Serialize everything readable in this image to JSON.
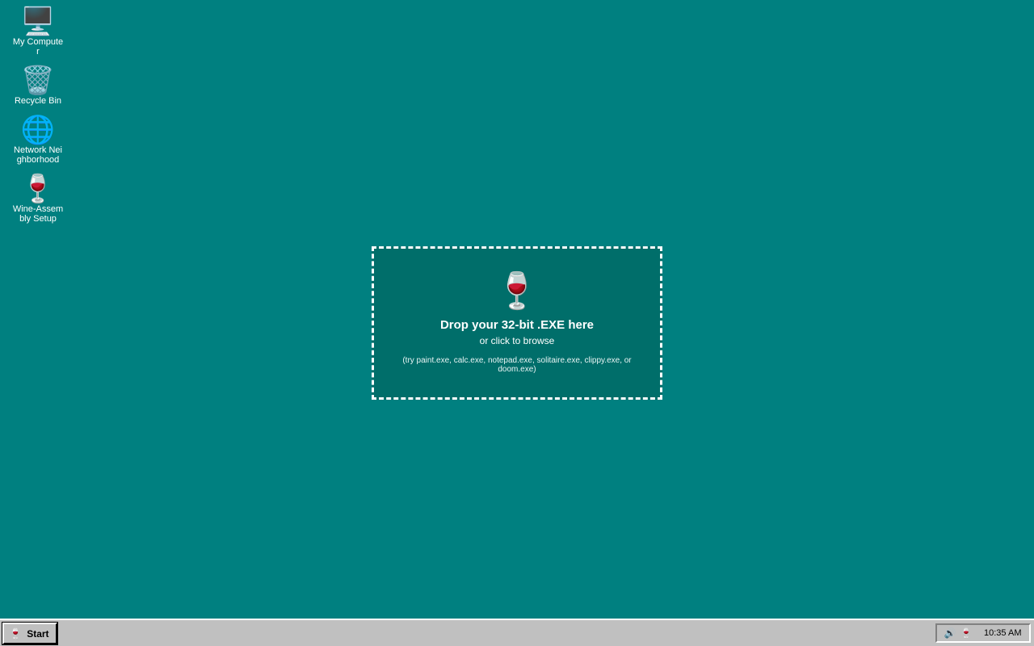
{
  "desktop": {
    "background_color": "#008080",
    "icons": [
      {
        "label": "My Computer",
        "glyph": "🖥️",
        "icon": "computer-icon"
      },
      {
        "label": "Recycle Bin",
        "glyph": "🗑️",
        "icon": "recycle-bin-icon"
      },
      {
        "label": "Network Neighborhood",
        "glyph": "🌐",
        "icon": "globe-icon"
      },
      {
        "label": "Wine-Assembly Setup",
        "glyph": "🍷",
        "icon": "wine-glass-icon"
      }
    ]
  },
  "drop_zone": {
    "glyph": "🍷",
    "icon": "wine-glass-icon",
    "title": "Drop your 32-bit .EXE here",
    "subtitle": "or click to browse",
    "hint": "(try paint.exe, calc.exe, notepad.exe, solitaire.exe, clippy.exe, or doom.exe)"
  },
  "taskbar": {
    "start": {
      "label": "Start",
      "glyph": "🍷",
      "icon": "wine-glass-icon"
    },
    "tray": {
      "icons": [
        {
          "glyph": "🔊",
          "icon": "speaker-icon"
        },
        {
          "glyph": "🍷",
          "icon": "wine-glass-icon"
        }
      ],
      "clock": "10:35 AM"
    }
  }
}
